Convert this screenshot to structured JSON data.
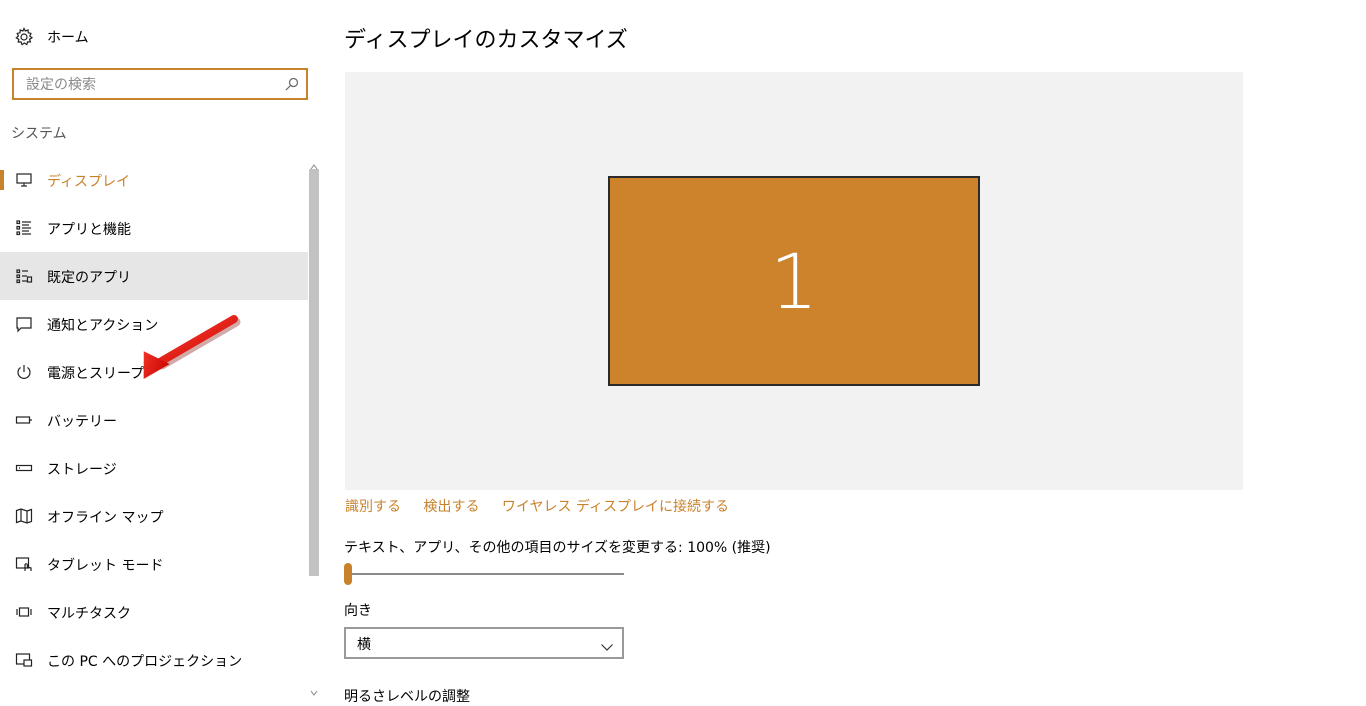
{
  "sidebar": {
    "home_label": "ホーム",
    "search": {
      "placeholder": "設定の検索",
      "value": ""
    },
    "section_title": "システム",
    "items": [
      {
        "label": "ディスプレイ",
        "icon": "monitor-icon",
        "selected": true
      },
      {
        "label": "アプリと機能",
        "icon": "apps-list-icon"
      },
      {
        "label": "既定のアプリ",
        "icon": "default-apps-icon",
        "hover": true
      },
      {
        "label": "通知とアクション",
        "icon": "notification-icon"
      },
      {
        "label": "電源とスリープ",
        "icon": "power-icon"
      },
      {
        "label": "バッテリー",
        "icon": "battery-icon"
      },
      {
        "label": "ストレージ",
        "icon": "storage-icon"
      },
      {
        "label": "オフライン マップ",
        "icon": "map-icon"
      },
      {
        "label": "タブレット モード",
        "icon": "tablet-mode-icon"
      },
      {
        "label": "マルチタスク",
        "icon": "multitask-icon"
      },
      {
        "label": "この PC へのプロジェクション",
        "icon": "projection-icon"
      }
    ]
  },
  "main": {
    "title": "ディスプレイのカスタマイズ",
    "monitor_number": "1",
    "links": {
      "identify": "識別する",
      "detect": "検出する",
      "wireless": "ワイヤレス ディスプレイに接続する"
    },
    "scale_label": "テキスト、アプリ、その他の項目のサイズを変更する: 100% (推奨)",
    "scale_slider_fraction": 0,
    "orientation_label": "向き",
    "orientation_value": "横",
    "brightness_label": "明るさレベルの調整"
  },
  "colors": {
    "accent": "#c9822c",
    "monitor_fill": "#cc832c",
    "preview_bg": "#f2f2f2",
    "hover_bg": "#e6e6e6",
    "annotation_arrow": "#e8100c"
  }
}
